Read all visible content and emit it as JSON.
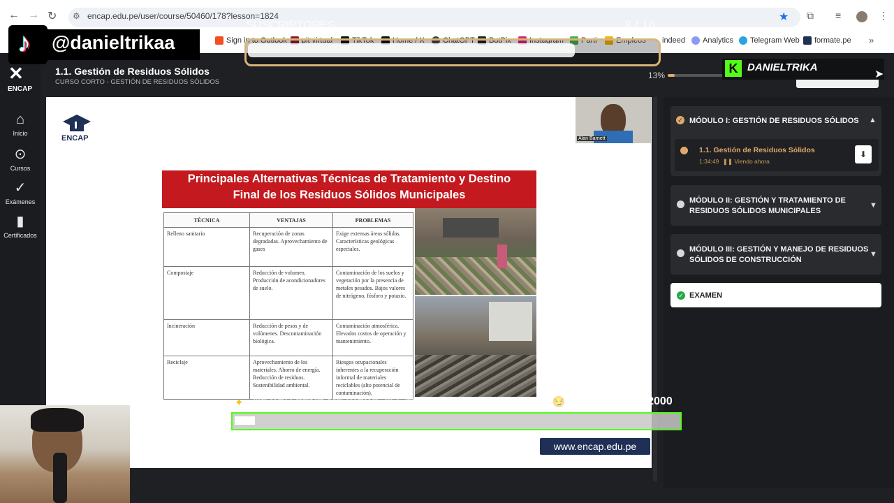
{
  "browser": {
    "url": "encap.edu.pe/user/course/50460/178?lesson=1824",
    "bookmarks": [
      "Sign in to Outlook",
      "pit virtual",
      "TikTok",
      "Home / X",
      "ChatGPT",
      "BotPix",
      "Instagram",
      "Parti",
      "Empleos",
      "indeed",
      "Analytics",
      "Telegram Web",
      "formate.pe"
    ]
  },
  "sidebar": {
    "brand": "ENCAP",
    "items": [
      {
        "label": "Inicio",
        "icon": "home-icon"
      },
      {
        "label": "Cursos",
        "icon": "play-circle-icon"
      },
      {
        "label": "Exámenes",
        "icon": "check-icon"
      },
      {
        "label": "Certificados",
        "icon": "bookmark-icon"
      }
    ]
  },
  "header": {
    "title": "1.1. Gestión de Residuos Sólidos",
    "subtitle": "CURSO CORTO - GESTIÓN DE RESIDUOS SÓLIDOS",
    "progress_text": "13%",
    "progress_value": 0.13
  },
  "slide": {
    "logo_text": "ENCAP",
    "cam_label": "Alan Barnett",
    "title_line1": "Principales Alternativas Técnicas de Tratamiento y Destino",
    "title_line2": "Final de los Residuos Sólidos Municipales",
    "table": {
      "headers": [
        "TÉCNICA",
        "VENTAJAS",
        "PROBLEMAS"
      ],
      "rows": [
        [
          "Relleno sanitario",
          "Recuperación de zonas degradadas. Aprovechamiento de gases",
          "Exige extensas áreas sólidas. Características geológicas especiales."
        ],
        [
          "Compostaje",
          "Reducción de volumen. Producción de acondicionadores de suelo.",
          "Contaminación de los suelos y vegetación por la presencia de metales pesados. Bajos valores de nitrógeno, fósforo y potasio."
        ],
        [
          "Incineración",
          "Reducción de pesos y de volúmenes. Descontaminación biológica.",
          "Contaminación atmosférica. Elevados costos de operación y mantenimiento."
        ],
        [
          "Reciclaje",
          "Aprovechamiento de los materiales. Ahorro de energía. Reducción de residuos. Sostenibilidad ambiental.",
          "Riesgos ocupacionales inherentes a la recuperación informal de materiales reciclables (alto potencial de contaminación)."
        ]
      ]
    },
    "site_url": "www.encap.edu.pe"
  },
  "panel": {
    "modules": [
      {
        "title": "MÓDULO I: GESTIÓN DE RESIDUOS SÓLIDOS",
        "expanded": true
      },
      {
        "title_line1": "MÓDULO II: GESTIÓN Y TRATAMIENTO DE",
        "title_line2": "RESIDUOS SÓLIDOS MUNICIPALES",
        "expanded": false
      },
      {
        "title_line1": "MÓDULO III: GESTIÓN Y MANEJO DE RESIDUOS",
        "title_line2": "SÓLIDOS DE CONSTRUCCIÓN",
        "expanded": false
      }
    ],
    "lesson": {
      "title": "1.1. Gestión de Residuos Sólidos",
      "duration": "1:34:49",
      "status": "Viendo ahora"
    },
    "exam_label": "EXAMEN"
  },
  "overlays": {
    "tiktok_handle": "@danieltrikaa",
    "subs_label": "SUSCRIPTORES",
    "subs_count": "8 / 10",
    "subs_value": 0.8,
    "kick_name": "DANIELTRIKA",
    "kick_goal_text": "\"IF YOU SEND ME KICKS, I'LL THINK ABOUT YOU ALL DAY 😏\"",
    "kick_count": "91 / 2000",
    "kick_value": 0.0455
  },
  "colors": {
    "accent": "#e0a86b",
    "kick_green": "#53fc18",
    "slide_red": "#c3191f",
    "brand_navy": "#1f2f56"
  }
}
